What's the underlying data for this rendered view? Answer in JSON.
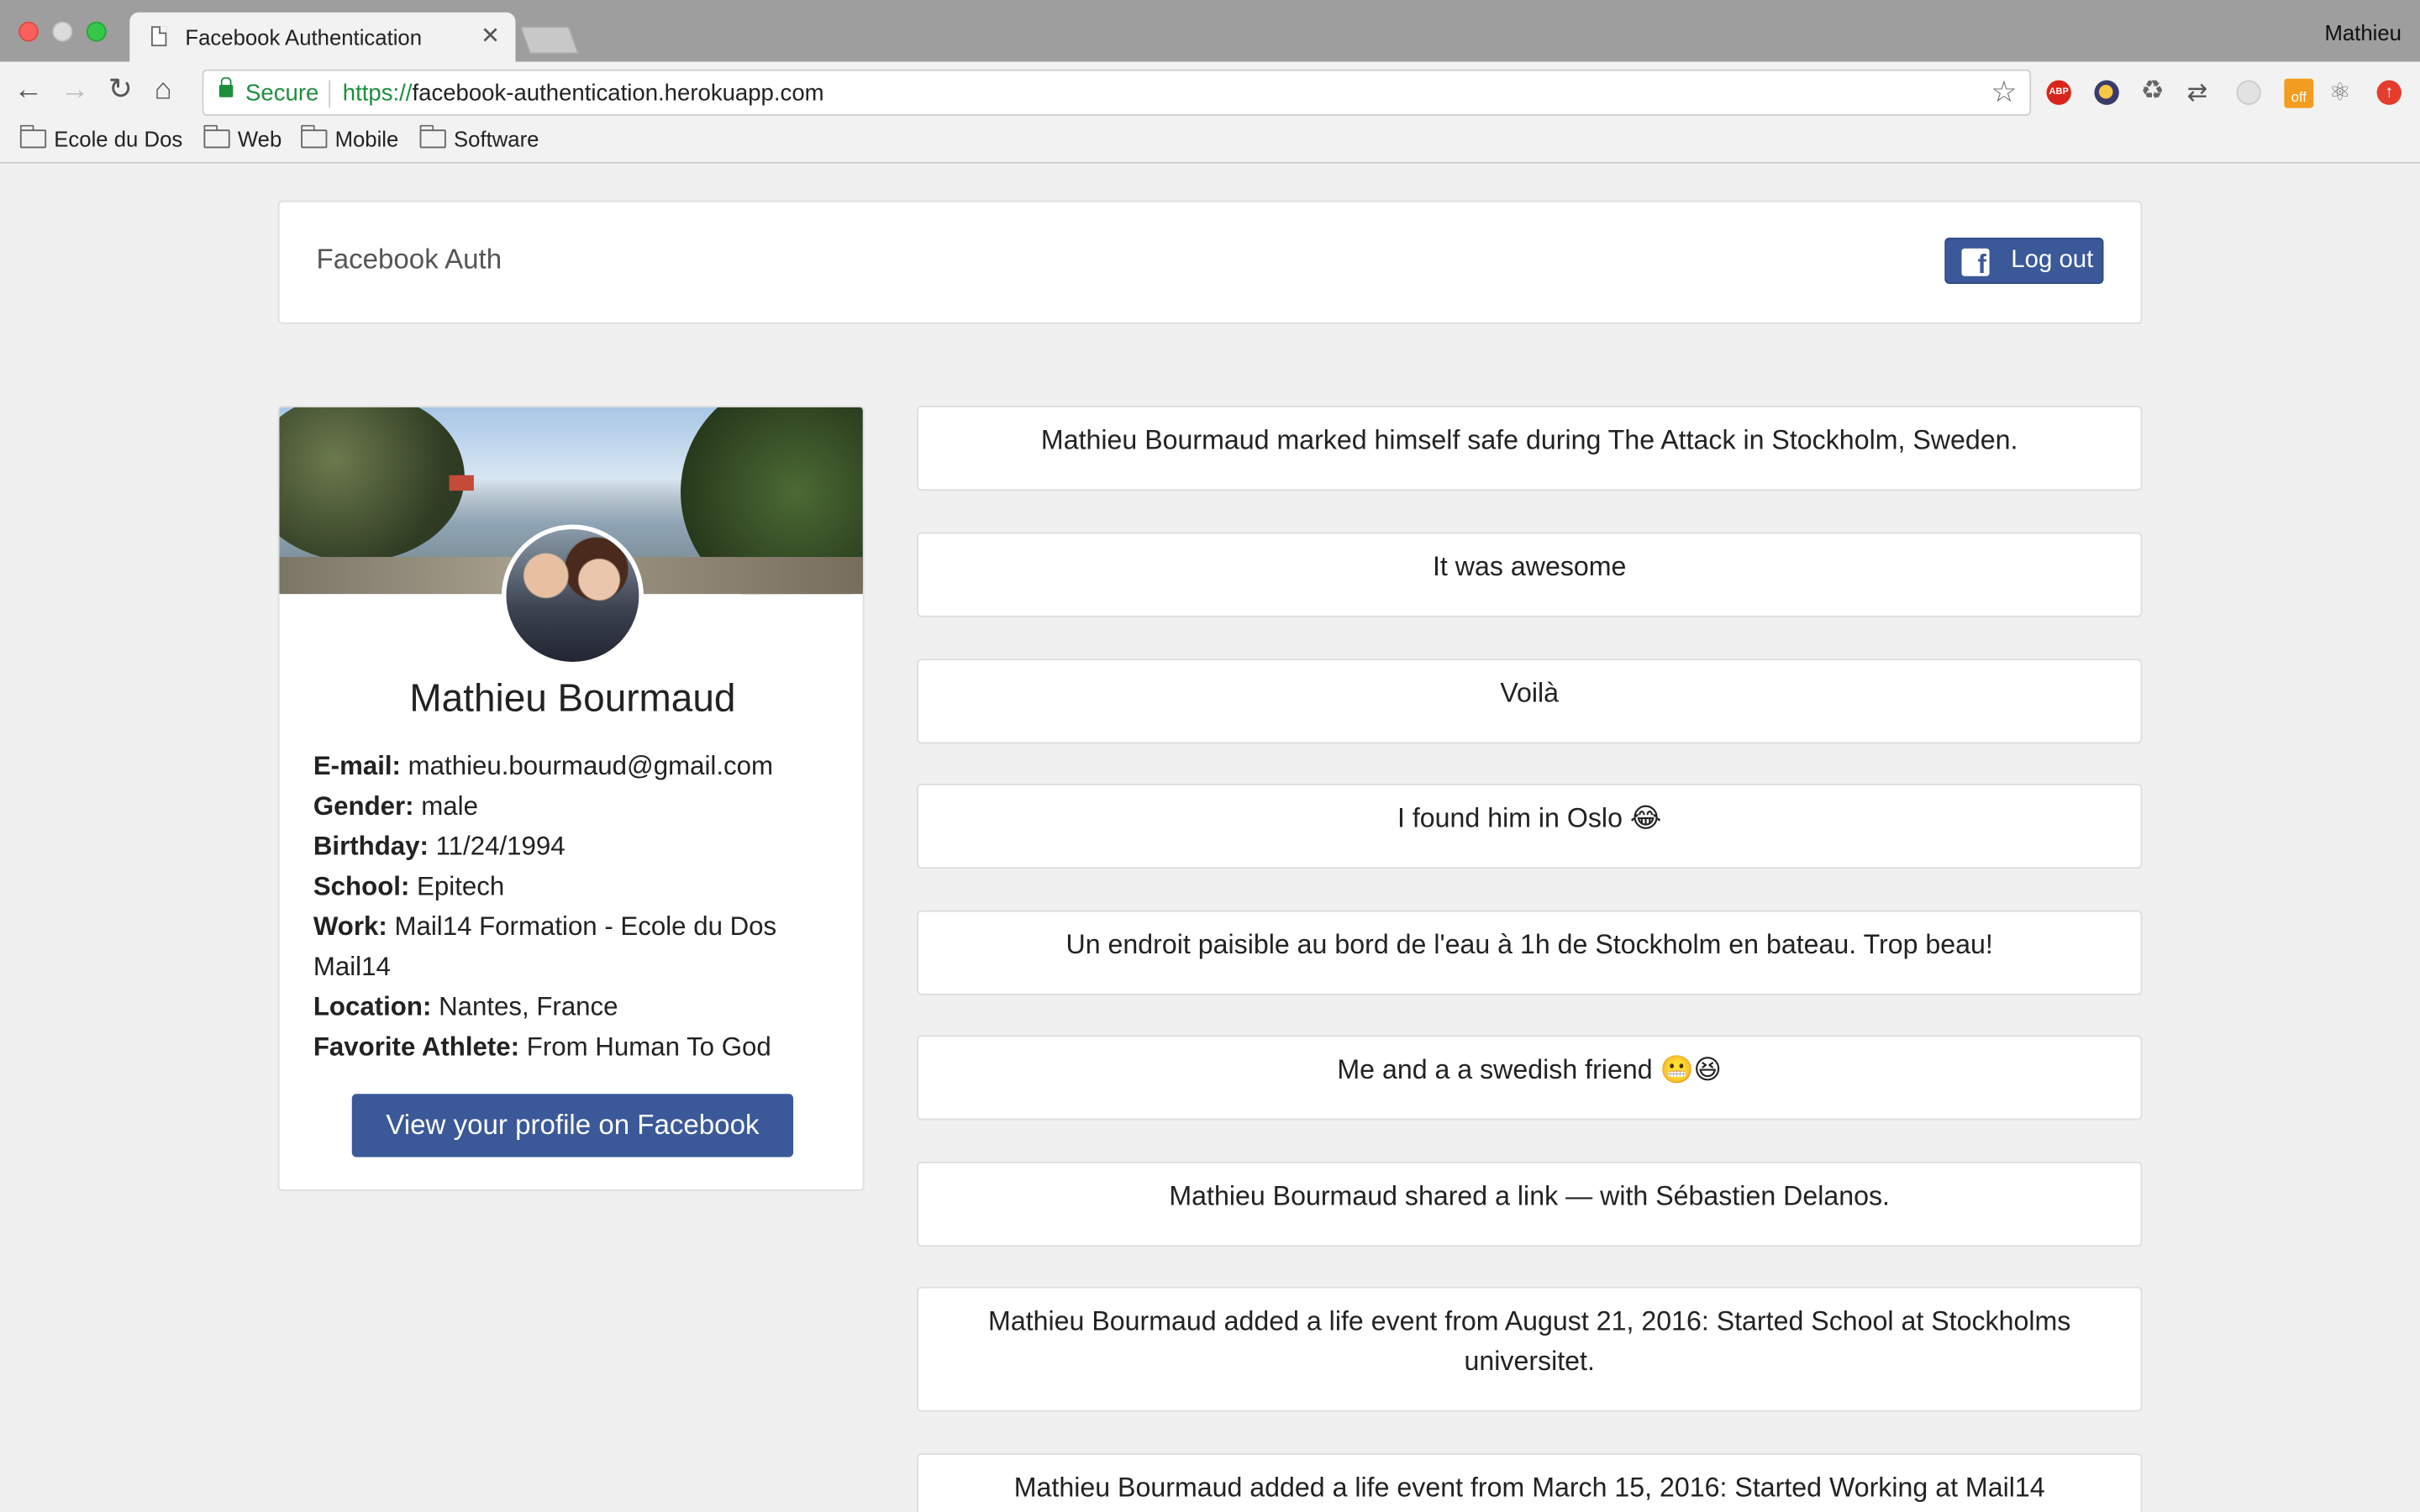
{
  "browser": {
    "tab_title": "Facebook Authentication",
    "profile_name": "Mathieu",
    "secure_label": "Secure",
    "url_scheme": "https://",
    "url_host": "facebook-authentication.herokuapp.com",
    "extensions": [
      "abp-icon",
      "moon-icon",
      "recycle-icon",
      "arrows-icon",
      "circle-icon",
      "off-icon",
      "react-icon",
      "upload-icon"
    ],
    "abp_label": "ABP",
    "off_label": "off",
    "bookmarks": [
      "Ecole du Dos",
      "Web",
      "Mobile",
      "Software"
    ]
  },
  "navbar": {
    "brand": "Facebook Auth",
    "logout_label": "Log out"
  },
  "profile": {
    "name": "Mathieu Bourmaud",
    "fields": [
      {
        "label": "E-mail:",
        "value": "mathieu.bourmaud@gmail.com"
      },
      {
        "label": "Gender:",
        "value": "male"
      },
      {
        "label": "Birthday:",
        "value": "11/24/1994"
      },
      {
        "label": "School:",
        "value": "Epitech"
      },
      {
        "label": "Work:",
        "value": "Mail14 Formation - Ecole du Dos Mail14"
      },
      {
        "label": "Location:",
        "value": "Nantes, France"
      },
      {
        "label": "Favorite Athlete:",
        "value": "From Human To God"
      }
    ],
    "view_button": "View your profile on Facebook"
  },
  "posts": [
    "Mathieu Bourmaud marked himself safe during The Attack in Stockholm, Sweden.",
    "It was awesome",
    "Voilà",
    "I found him in Oslo 😂",
    "Un endroit paisible au bord de l'eau à 1h de Stockholm en bateau. Trop beau!",
    "Me and a a swedish friend 😬😆",
    "Mathieu Bourmaud shared a link — with Sébastien Delanos.",
    "Mathieu Bourmaud added a life event from August 21, 2016: Started School at Stockholms universitet.",
    "Mathieu Bourmaud added a life event from March 15, 2016: Started Working at Mail14"
  ],
  "colors": {
    "facebook_blue": "#3b5998",
    "secure_green": "#1e8e3e"
  }
}
